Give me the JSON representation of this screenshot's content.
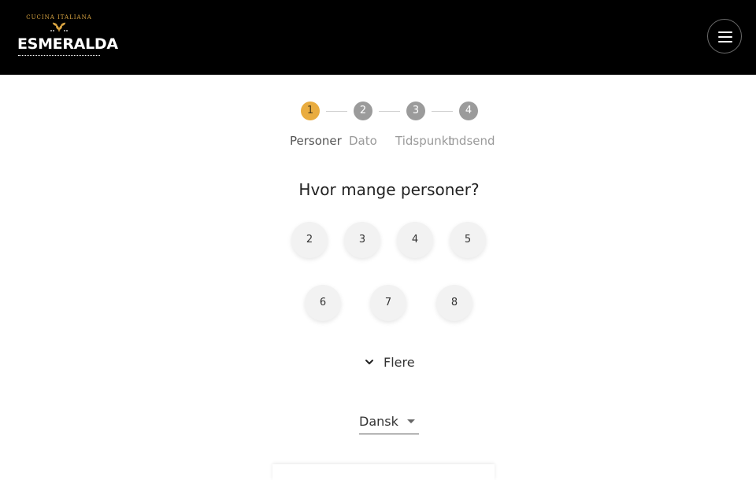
{
  "brand": {
    "tagline": "CUCINA ITALIANA",
    "name": "ESMERALDA"
  },
  "header": {
    "menu_icon": "hamburger-menu-icon"
  },
  "stepper": {
    "steps": [
      {
        "number": "1",
        "label": "Personer",
        "active": true
      },
      {
        "number": "2",
        "label": "Dato",
        "active": false
      },
      {
        "number": "3",
        "label": "Tidspunkt",
        "active": false
      },
      {
        "number": "4",
        "label": "Indsend",
        "active": false
      }
    ]
  },
  "main": {
    "question": "Hvor mange personer?",
    "options": [
      "2",
      "3",
      "4",
      "5",
      "6",
      "7",
      "8"
    ],
    "more_label": "Flere",
    "more_icon": "chevron-down-icon"
  },
  "language": {
    "selected": "Dansk"
  },
  "colors": {
    "header_bg": "#000000",
    "active_step": "#e9ac3f",
    "inactive_step": "#9b9b9b"
  }
}
